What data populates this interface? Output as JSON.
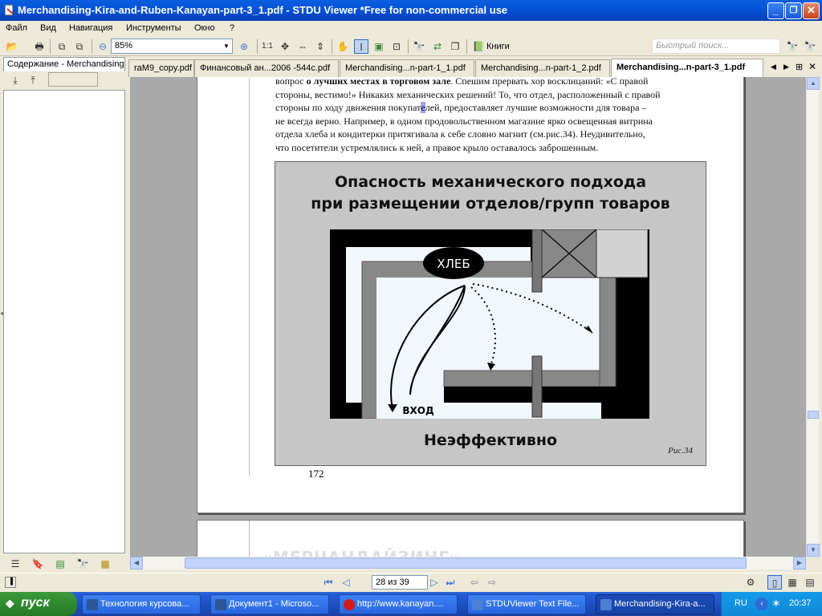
{
  "window": {
    "title": "Merchandising-Kira-and-Ruben-Kanayan-part-3_1.pdf - STDU Viewer *Free for non-commercial use",
    "buttons": [
      "_",
      "❐",
      "✕"
    ]
  },
  "menu": [
    "Файл",
    "Вид",
    "Навигация",
    "Инструменты",
    "Окно",
    "?"
  ],
  "toolbar": {
    "zoom": "85%",
    "actual_size": "1:1",
    "books_label": "Книги",
    "search_placeholder": "Быстрый поиск..."
  },
  "sidebar": {
    "tab": "Содержание - Merchandising-"
  },
  "tabs": [
    {
      "label": "raM9_copy.pdf",
      "active": false
    },
    {
      "label": "Финансовый ан...2006 -544c.pdf",
      "active": false
    },
    {
      "label": "Merchandising...n-part-1_1.pdf",
      "active": false
    },
    {
      "label": "Merchandising...n-part-1_2.pdf",
      "active": false
    },
    {
      "label": "Merchandising...n-part-3_1.pdf",
      "active": true
    }
  ],
  "document": {
    "paragraph_lines": [
      {
        "pre": "вопрос ",
        "bold": "о лучших местах в торговом зале",
        "post": ". Спешим прервать хор восклицаний: «С правой"
      },
      {
        "text": "стороны, вестимо!» Никаких механических решений! То, что отдел, расположенный с правой"
      },
      {
        "pre": "стороны по ходу движения покупат",
        "hl": "е",
        "post": "лей, предоставляет лучшие возможности для товара –"
      },
      {
        "text": "не всегда верно.  Например, в одном продовольственном магазине ярко освещенная витрина"
      },
      {
        "text": "отдела хлеба и кондитерки притягивала к себе словно магнит (см.рис.34). Неудивительно,"
      },
      {
        "text": "что посетители устремлялись к ней, а правое крыло оставалось заброшенным."
      }
    ],
    "figure": {
      "title_line1": "Опасность механического подхода",
      "title_line2": "при размещении отделов/групп товаров",
      "bread_label": "ХЛЕБ",
      "entrance_label": "ВХОД",
      "caption": "Неэффективно",
      "ref": "Рис.34"
    },
    "page_number": "172",
    "next_page_heading": "«МЕРЧАНДАЙЗИНГ»"
  },
  "statusbar": {
    "page_indicator": "28 из 39"
  },
  "taskbar": {
    "start": "пуск",
    "tasks": [
      {
        "label": "Технология курсова...",
        "active": false,
        "color": "#2b5797"
      },
      {
        "label": "Документ1 - Microso...",
        "active": false,
        "color": "#2b5797"
      },
      {
        "label": "http://www.kanayan....",
        "active": false,
        "color": "#d41a1a"
      },
      {
        "label": "STDUViewer Text File...",
        "active": false,
        "color": "#4a7fd4"
      },
      {
        "label": "Merchandising-Kira-a...",
        "active": true,
        "color": "#4a7fd4"
      }
    ],
    "lang": "RU",
    "clock": "20:37"
  }
}
